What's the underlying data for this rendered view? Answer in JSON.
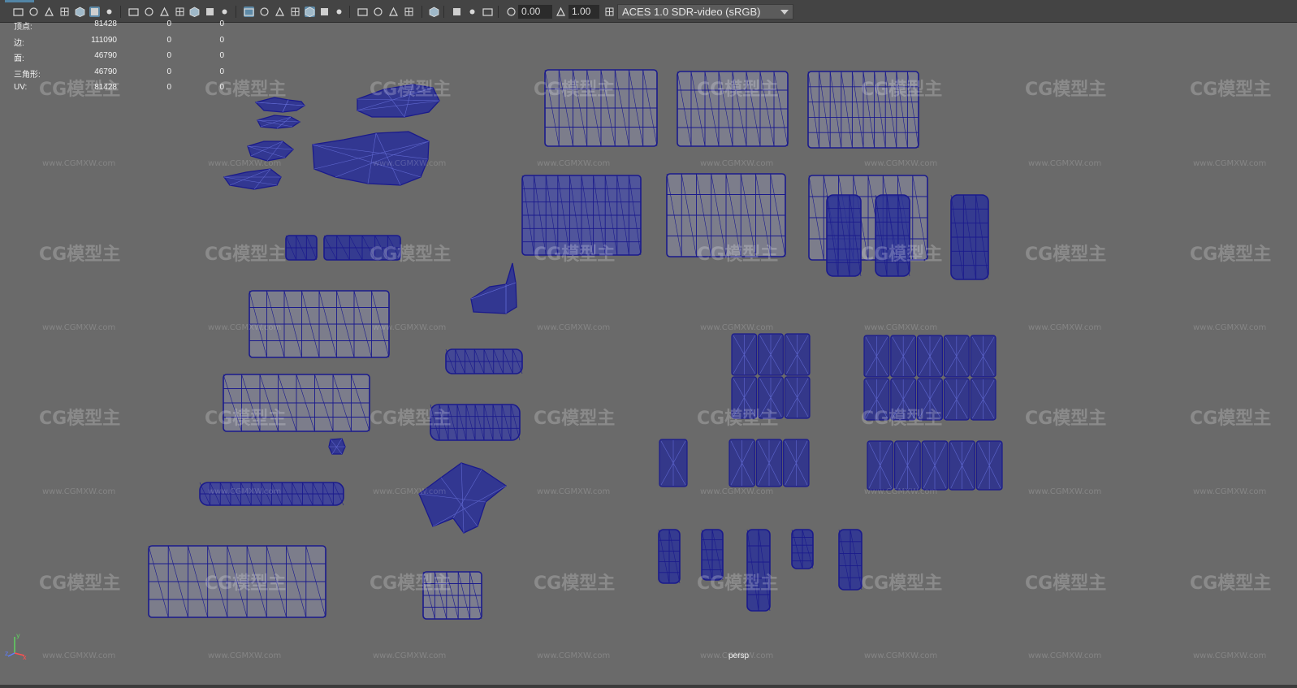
{
  "toolbar": {
    "exposure_value": "0.00",
    "gamma_value": "1.00",
    "colorspace_label": "ACES 1.0 SDR-video (sRGB)",
    "accent_color": "#5d8aa8",
    "icons": [
      "camera-select-icon",
      "camera-lock-icon",
      "camera-attributes-icon",
      "bookmark-icon",
      "image-plane-icon",
      "grease-pencil-icon",
      "grid-icon",
      "film-gate-icon",
      "resolution-gate-icon",
      "gate-mask-icon",
      "field-chart-icon",
      "safe-action-icon",
      "safe-title-icon",
      "wireframe-icon",
      "smooth-shade-icon",
      "default-material-icon",
      "wireframe-on-shaded-icon",
      "xray-icon",
      "use-all-lights-icon",
      "shadows-icon",
      "screen-space-ao-icon",
      "motion-blur-icon",
      "multisample-aa-icon",
      "depth-of-field-icon",
      "isolate-select-icon",
      "xray-joints-icon",
      "xray-active-icon",
      "backface-culling-icon",
      "exposure-icon",
      "gamma-icon",
      "color-management-icon"
    ]
  },
  "hud": {
    "rows": [
      {
        "label": "顶点:",
        "v1": "81428",
        "v2": "0",
        "v3": "0"
      },
      {
        "label": "边:",
        "v1": "111090",
        "v2": "0",
        "v3": "0"
      },
      {
        "label": "面:",
        "v1": "46790",
        "v2": "0",
        "v3": "0"
      },
      {
        "label": "三角形:",
        "v1": "46790",
        "v2": "0",
        "v3": "0"
      },
      {
        "label": "UV:",
        "v1": "81428",
        "v2": "0",
        "v3": "0"
      }
    ]
  },
  "viewport": {
    "camera_label": "persp",
    "background_color": "#6a6a6a",
    "wire_color": "#1a1a8c"
  },
  "axis": {
    "x": "x",
    "y": "y",
    "z": "z"
  },
  "watermark": {
    "logo": "CG模型主",
    "url": "www.CGMXW.com"
  }
}
